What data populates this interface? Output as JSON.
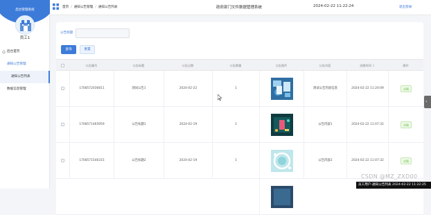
{
  "sidebar": {
    "system_title": "后台管理系统",
    "user_name": "员工1",
    "menu": [
      {
        "label": "后台首页"
      },
      {
        "label": "通知公告管理"
      },
      {
        "label": "通知公告列表"
      },
      {
        "label": "数据信息管理"
      }
    ]
  },
  "topbar": {
    "breadcrumb": [
      "首页",
      "通知公告管理",
      "通知公告列表"
    ],
    "system_name": "政府部门文件数据管理系统",
    "datetime": "2024-02-22 11:22:24",
    "logout_label": "退出登录"
  },
  "search": {
    "label": "公告标题",
    "placeholder": "",
    "search_button": "查询",
    "reset_button": "重置"
  },
  "table": {
    "columns": [
      "",
      "公告编号",
      "公告标题",
      "公告日期",
      "公告数量",
      "公告图片",
      "公告内容",
      "创建时间",
      "操作"
    ],
    "rows": [
      {
        "id": "1708572036811",
        "title": "测试公告1",
        "date": "2024-02-22",
        "count": "1",
        "content": "测试公告内容信息",
        "created": "2024-02-22 11:20:09",
        "action": "详情"
      },
      {
        "id": "1708571465959",
        "title": "公告标题1",
        "date": "2024-02-19",
        "count": "1",
        "content": "公告内容1",
        "created": "2024-02-22 11:07:32",
        "action": "详情"
      },
      {
        "id": "1708571546315",
        "title": "公告标题2",
        "date": "2024-02-19",
        "count": "1",
        "content": "公告内容2",
        "created": "2024-02-22 11:07:32",
        "action": "详情"
      }
    ]
  },
  "overlay": {
    "watermark": "CSDN @MZ_ZXD00",
    "footer_text": "员工用户-通知公告列表 2024-02-22 11:22:25"
  },
  "colors": {
    "accent": "#3d7bd9",
    "success": "#67c23a"
  }
}
